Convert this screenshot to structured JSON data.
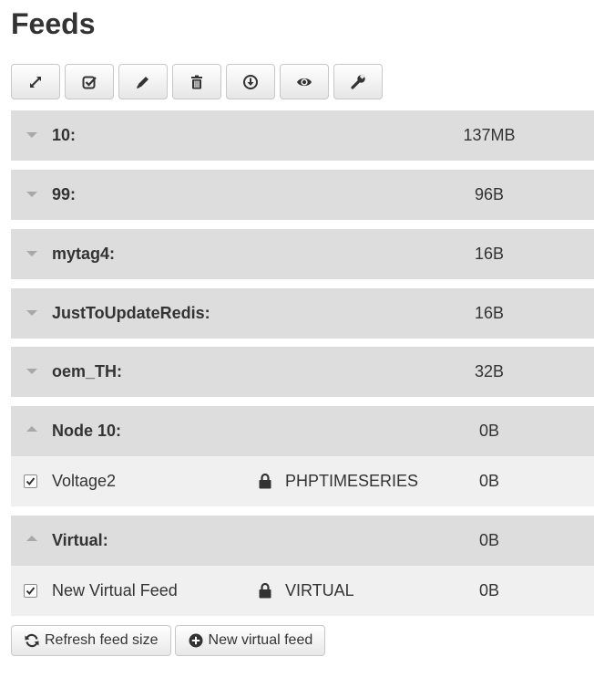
{
  "page": {
    "title": "Feeds"
  },
  "toolbar": [
    {
      "name": "expand-collapse-button",
      "icon": "expand-icon"
    },
    {
      "name": "select-all-button",
      "icon": "check-square-icon"
    },
    {
      "name": "edit-button",
      "icon": "pencil-icon"
    },
    {
      "name": "delete-button",
      "icon": "trash-icon"
    },
    {
      "name": "download-button",
      "icon": "download-circle-icon"
    },
    {
      "name": "view-button",
      "icon": "eye-icon"
    },
    {
      "name": "settings-button",
      "icon": "wrench-icon"
    }
  ],
  "groups": [
    {
      "name": "10:",
      "size": "137MB",
      "expanded": false,
      "feeds": []
    },
    {
      "name": "99:",
      "size": "96B",
      "expanded": false,
      "feeds": []
    },
    {
      "name": "mytag4:",
      "size": "16B",
      "expanded": false,
      "feeds": []
    },
    {
      "name": "JustToUpdateRedis:",
      "size": "16B",
      "expanded": false,
      "feeds": []
    },
    {
      "name": "oem_TH:",
      "size": "32B",
      "expanded": false,
      "feeds": []
    },
    {
      "name": "Node 10:",
      "size": "0B",
      "expanded": true,
      "feeds": [
        {
          "name": "Voltage2",
          "engine": "PHPTIMESERIES",
          "size": "0B",
          "checked": true,
          "locked": true
        }
      ]
    },
    {
      "name": "Virtual:",
      "size": "0B",
      "expanded": true,
      "feeds": [
        {
          "name": "New Virtual Feed",
          "engine": "VIRTUAL",
          "size": "0B",
          "checked": true,
          "locked": true
        }
      ]
    }
  ],
  "actions": {
    "refresh_label": "Refresh feed size",
    "new_virtual_label": "New virtual feed"
  }
}
